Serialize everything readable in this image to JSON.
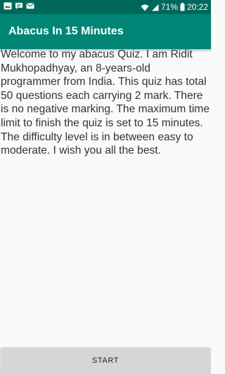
{
  "status_bar": {
    "icons": [
      "gallery-notification-icon",
      "messenger-notification-icon",
      "mail-notification-icon",
      "wifi-icon",
      "signal-icon",
      "battery-icon"
    ],
    "battery": "71%",
    "time": "20:22"
  },
  "app_bar": {
    "title": "Abacus In 15 Minutes",
    "color": "#008577",
    "status_color": "#00685b"
  },
  "main": {
    "intro_text": "Welcome to my abacus Quiz. I am Ridit Mukhopadhyay, an 8-years-old programmer from India. This quiz has total 50 questions each carrying 2 mark. There is no negative marking. The maximum time limit to finish the quiz is set to 15 minutes. The difficulty level is in between easy to moderate. I wish you all the best."
  },
  "start_button": {
    "label": "START"
  }
}
